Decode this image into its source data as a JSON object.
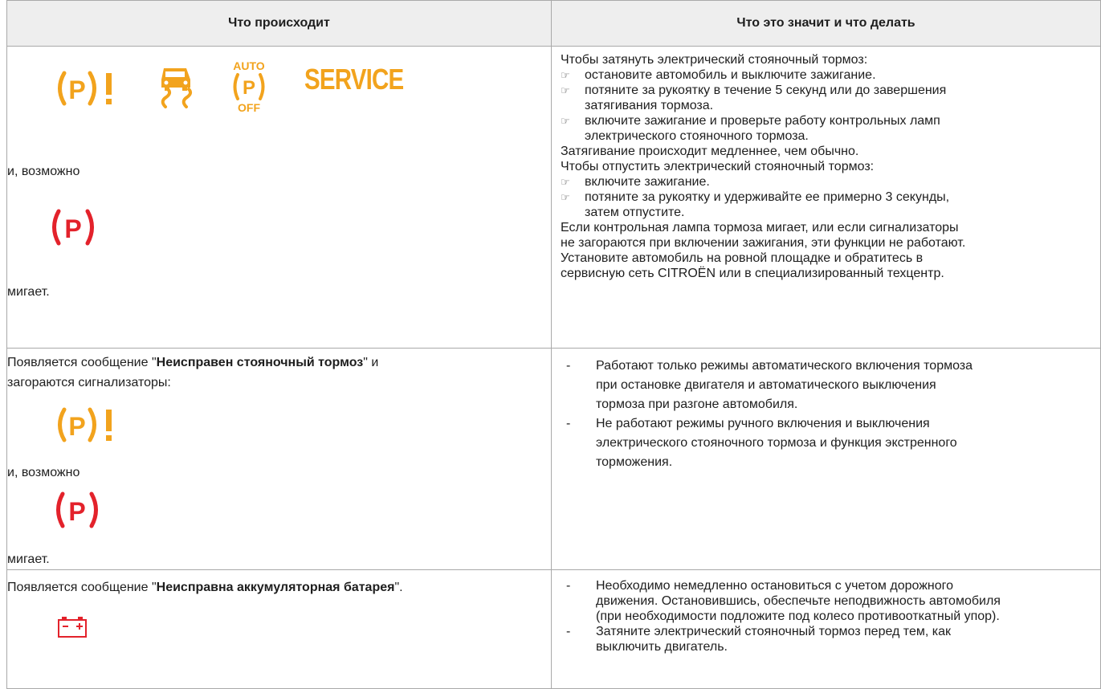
{
  "header": {
    "col1": "Что происходит",
    "col2": "Что это значит и что делать"
  },
  "colors": {
    "warning_orange": "#f2a31d",
    "alert_red": "#e3222b",
    "header_bg": "#eeeeee",
    "border": "#a9a9a9"
  },
  "icons": {
    "row1": [
      "parking-brake-fault-icon",
      "stability-control-icon",
      "auto-parking-off-icon",
      "service-icon"
    ],
    "row1_auto_top": "AUTO",
    "row1_auto_bottom": "OFF",
    "row1_service": "SERVICE",
    "parking_p": "P",
    "parking_excl": "!",
    "battery_minus": "−",
    "battery_plus": "+"
  },
  "row1": {
    "left_maybe": "и, возможно",
    "left_blinks": "мигает.",
    "right": {
      "apply_title": "Чтобы затянуть электрический стояночный тормоз:",
      "apply_steps": [
        "остановите автомобиль и выключите зажигание.",
        "потяните за рукоятку в течение 5 секунд или до завершения",
        "затягивания тормоза.",
        "включите зажигание и проверьте работу контрольных ламп",
        "электрического стояночного тормоза."
      ],
      "slower": "Затягивание происходит медленнее, чем обычно.",
      "release_title": "Чтобы отпустить электрический стояночный тормоз:",
      "release_steps": [
        "включите зажигание.",
        "потяните за рукоятку и удерживайте ее примерно 3 секунды,",
        "затем отпустите."
      ],
      "note_lines": [
        "Если контрольная лампа тормоза мигает, или если сигнализаторы",
        "не загораются при включении зажигания, эти функции не работают.",
        "Установите автомобиль на ровной площадке и обратитесь в",
        "сервисную сеть CITROËN или в специализированный техцентр."
      ]
    }
  },
  "row2": {
    "left_prefix": "Появляется сообщение \"",
    "left_bold": "Неисправен стояночный тормоз",
    "left_suffix": "\" и",
    "left_line2": "загораются сигнализаторы:",
    "left_maybe": "и, возможно",
    "left_blinks": "мигает.",
    "right_items": [
      {
        "lines": [
          "Работают только режимы автоматического включения тормоза",
          "при остановке двигателя и автоматического выключения",
          "тормоза при разгоне автомобиля."
        ]
      },
      {
        "lines": [
          "Не работают режимы ручного включения и выключения",
          "электрического стояночного тормоза и функция экстренного",
          "торможения."
        ]
      }
    ]
  },
  "row3": {
    "left_prefix": "Появляется сообщение \"",
    "left_bold": "Неисправна аккумуляторная батарея",
    "left_suffix": "\".",
    "right_items": [
      {
        "lines": [
          "Необходимо немедленно остановиться с учетом дорожного",
          "движения. Остановившись, обеспечьте неподвижность автомобиля",
          "(при необходимости подложите под колесо противооткатный упор)."
        ]
      },
      {
        "lines": [
          "Затяните электрический стояночный тормоз перед тем, как",
          "выключить двигатель."
        ]
      }
    ]
  },
  "dash": "-",
  "finger_symbol": "☞"
}
